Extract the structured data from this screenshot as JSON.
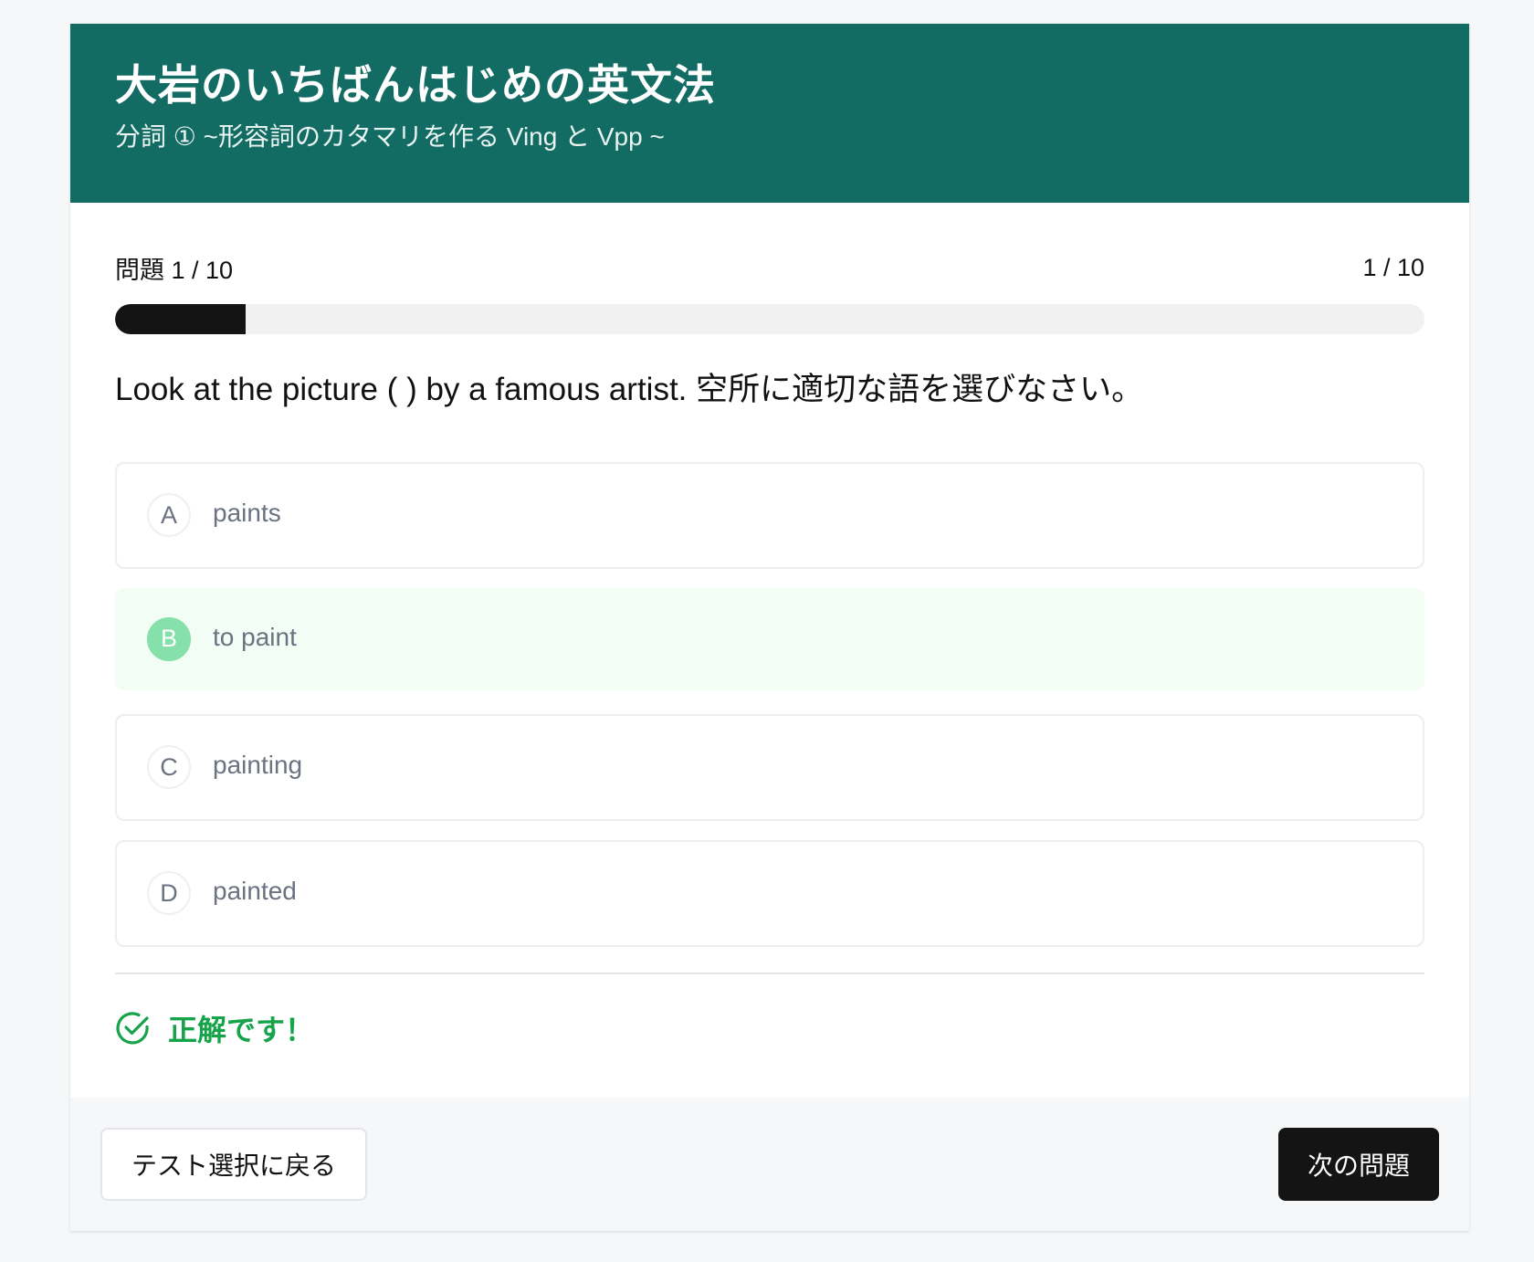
{
  "header": {
    "title": "大岩のいちばんはじめの英文法",
    "subtitle": "分詞 ① ~形容詞のカタマリを作る Ving と Vpp ~"
  },
  "progress": {
    "label": "問題 1 / 10",
    "counter": "1 / 10",
    "current": 1,
    "total": 10,
    "fraction": 0.1
  },
  "question": {
    "text": "Look at the picture ( ) by a famous artist. 空所に適切な語を選びなさい。"
  },
  "options": [
    {
      "letter": "A",
      "text": "paints",
      "selected": false
    },
    {
      "letter": "B",
      "text": "to paint",
      "selected": true
    },
    {
      "letter": "C",
      "text": "painting",
      "selected": false
    },
    {
      "letter": "D",
      "text": "painted",
      "selected": false
    }
  ],
  "result": {
    "icon": "check-circle-icon",
    "text": "正解です！",
    "color": "#16a34a"
  },
  "footer": {
    "back_label": "テスト選択に戻る",
    "next_label": "次の問題"
  },
  "colors": {
    "header_bg": "#136c63",
    "progress_fill": "#141414",
    "selected_bg": "#f2fdf6",
    "selected_badge": "#86e0a9"
  }
}
